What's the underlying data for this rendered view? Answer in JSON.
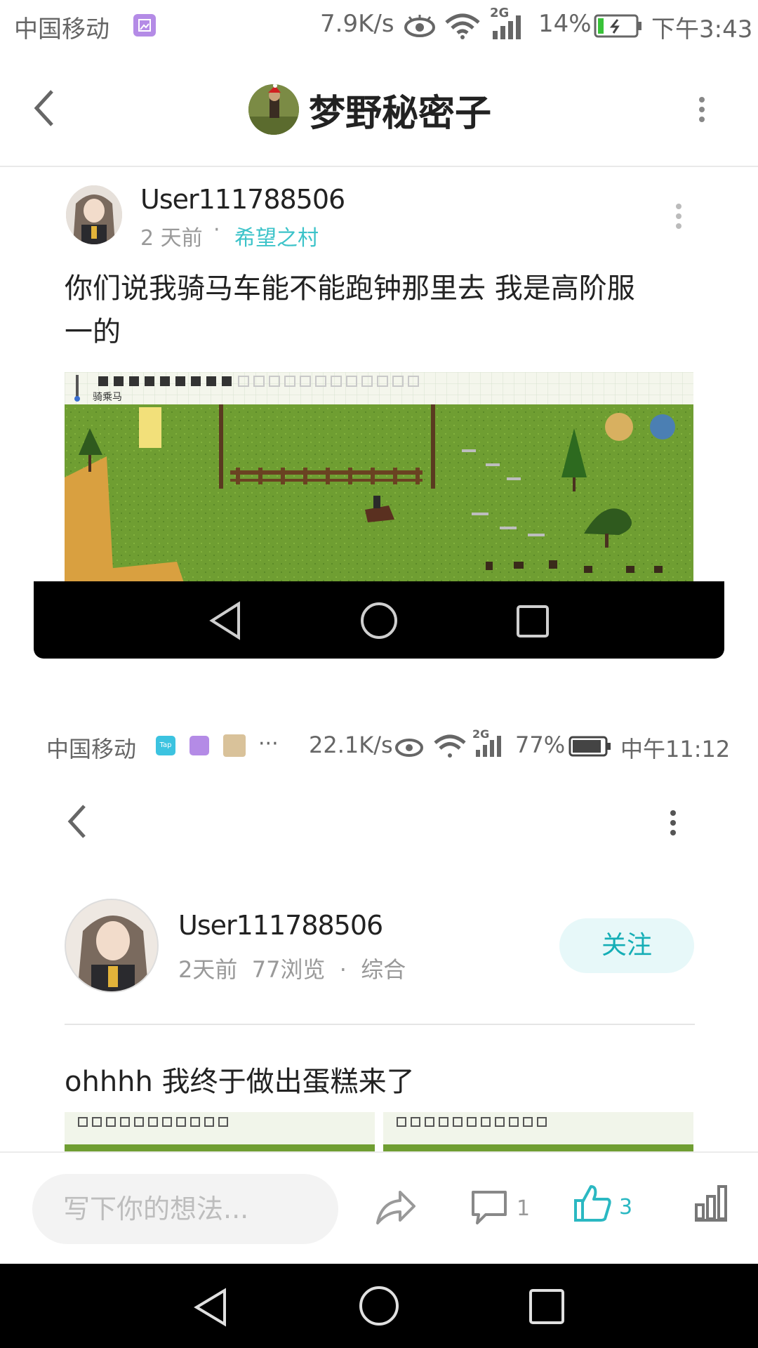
{
  "status_top": {
    "carrier": "中国移动",
    "speed": "7.9K/s",
    "network": "2G",
    "battery": "14%",
    "time": "下午3:43"
  },
  "header": {
    "title": "梦野秘密子"
  },
  "post1": {
    "username": "User111788506",
    "time": "2 天前",
    "tag": "希望之村",
    "text_line1": "你们说我骑马车能不能跑钟那里去 我是高阶服",
    "text_line2": "一的",
    "game_label": "骑乘马"
  },
  "status_inner": {
    "carrier": "中国移动",
    "speed": "22.1K/s",
    "network": "2G",
    "battery": "77%",
    "time": "中午11:12",
    "more": "···"
  },
  "post2": {
    "username": "User111788506",
    "meta": "2天前  77浏览  ·  综合",
    "follow_label": "关注",
    "text": "ohhhh 我终于做出蛋糕来了"
  },
  "bottom": {
    "input_placeholder": "写下你的想法...",
    "comment_count": "1",
    "like_count": "3"
  },
  "colors": {
    "accent": "#3cc3c9",
    "follow_bg": "#e7f8f9"
  },
  "icons": [
    "back-arrow-icon",
    "more-vertical-icon",
    "share-icon",
    "comment-icon",
    "thumbs-up-icon",
    "stats-icon",
    "nav-back-icon",
    "nav-home-icon",
    "nav-recents-icon",
    "wifi-icon",
    "signal-icon",
    "battery-icon",
    "eye-icon",
    "gallery-icon"
  ]
}
